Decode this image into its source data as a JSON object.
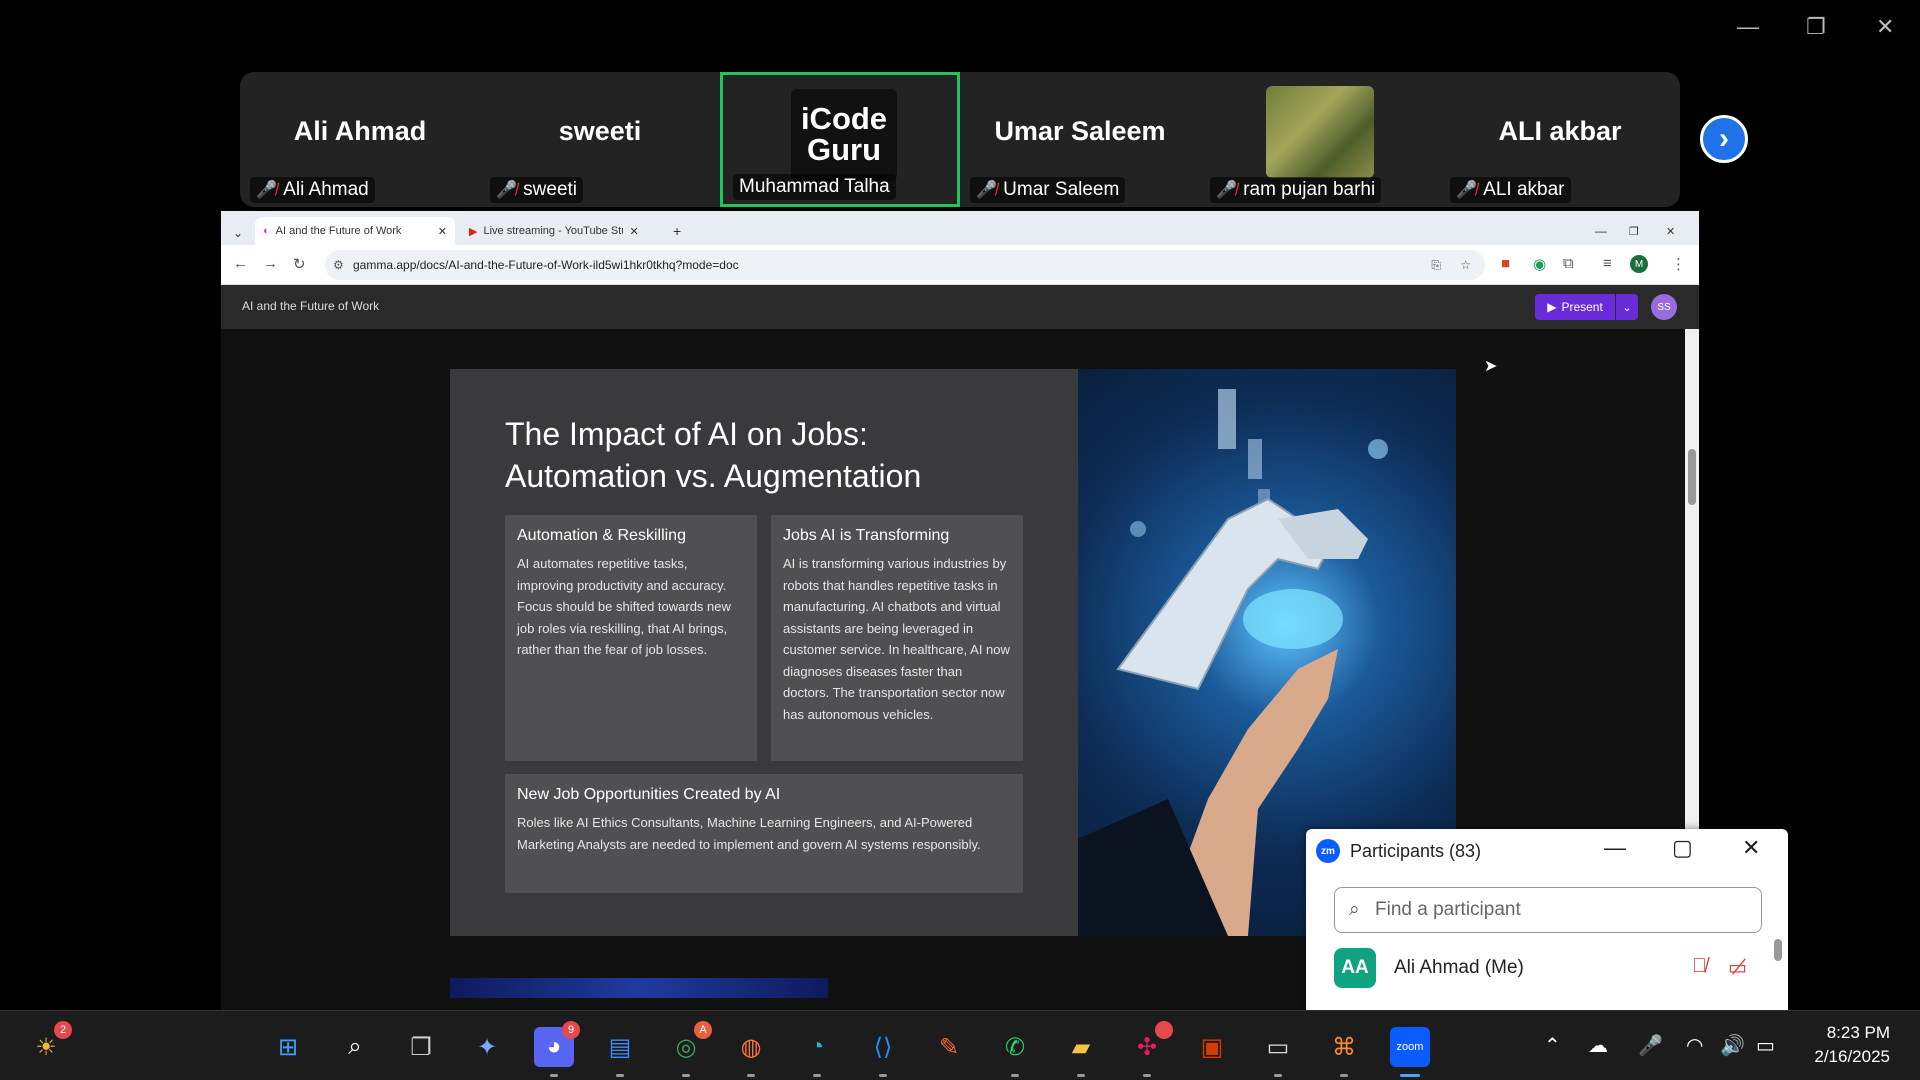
{
  "window_controls": {
    "minimize": "—",
    "restore": "❐",
    "close": "✕"
  },
  "gallery": {
    "tiles": [
      {
        "display": "Ali Ahmad",
        "name": "Ali Ahmad",
        "muted": true
      },
      {
        "display": "sweeti",
        "name": "sweeti",
        "muted": true
      },
      {
        "display": "iCode Guru",
        "name": "Muhammad Talha",
        "muted": false,
        "active": true
      },
      {
        "display": "Umar Saleem",
        "name": "Umar Saleem",
        "muted": true
      },
      {
        "display": "",
        "name": "ram pujan barhi",
        "muted": true
      },
      {
        "display": "ALI akbar",
        "name": "ALI akbar",
        "muted": true
      }
    ],
    "logo_line1": "iCode",
    "logo_line2": "Guru",
    "next_icon": "›"
  },
  "browser": {
    "tabs": [
      {
        "label": "AI and the Future of Work",
        "active": true
      },
      {
        "label": "Live streaming - YouTube Studi",
        "active": false
      }
    ],
    "new_tab": "+",
    "url": "gamma.app/docs/AI-and-the-Future-of-Work-ild5wi1hkr0tkhq?mode=doc",
    "profile_initial": "M"
  },
  "gamma": {
    "doc_title": "AI and the Future of Work",
    "present_label": "Present",
    "avatar": "SS"
  },
  "slide": {
    "title_line1": "The Impact of AI on Jobs:",
    "title_line2": "Automation vs. Augmentation",
    "box1": {
      "heading": "Automation & Reskilling",
      "body": "AI automates repetitive tasks, improving productivity and accuracy. Focus should be shifted towards new job roles via reskilling, that AI brings, rather than the fear of job losses."
    },
    "box2": {
      "heading": "Jobs AI is Transforming",
      "body": "AI is transforming various industries by robots that handles repetitive tasks in manufacturing. AI chatbots and virtual assistants are being leveraged in customer service. In healthcare, AI now diagnoses diseases faster than doctors. The transportation sector now has autonomous vehicles."
    },
    "box3": {
      "heading": "New Job Opportunities Created by AI",
      "body": "Roles like AI Ethics Consultants, Machine Learning Engineers, and AI-Powered Marketing Analysts are needed to implement and govern AI systems responsibly."
    }
  },
  "participants": {
    "title": "Participants (83)",
    "logo": "zm",
    "search_placeholder": "Find a participant",
    "rows": [
      {
        "initials": "AA",
        "name": "Ali Ahmad (Me)"
      }
    ]
  },
  "taskbar": {
    "weather_badge": "2",
    "discord_badge": "9",
    "chrome_badge": "A",
    "time": "8:23 PM",
    "date": "2/16/2025"
  }
}
